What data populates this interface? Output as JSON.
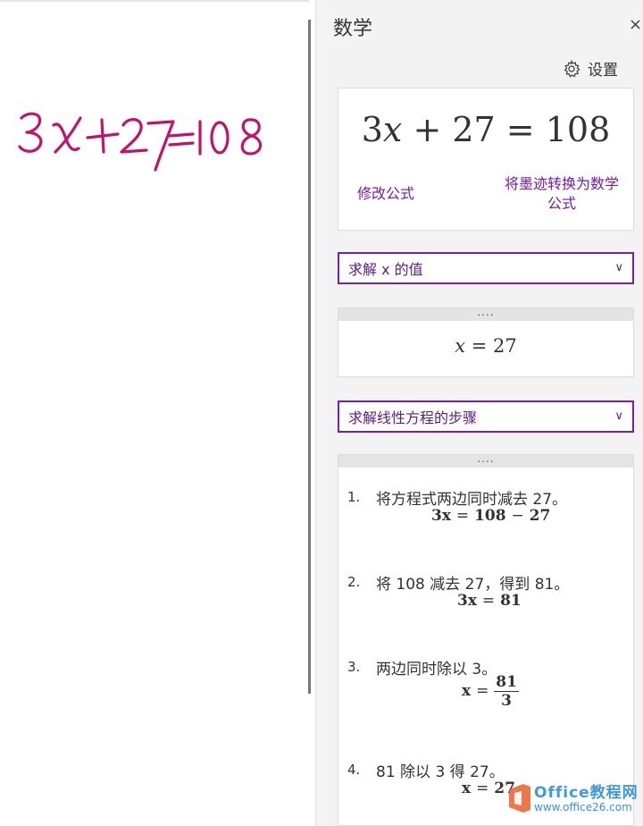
{
  "canvas": {
    "ink_equation": "3x+27=108",
    "ink_color": "#c0136b"
  },
  "pane": {
    "title": "数学",
    "close_label": "×",
    "settings_label": "设置"
  },
  "equation_card": {
    "display": {
      "coef": "3",
      "var": "x",
      "rest": "+ 27 = 108"
    },
    "edit_link": "修改公式",
    "convert_link": "将墨迹转换为数学公式"
  },
  "action_select": {
    "value": "求解 x 的值"
  },
  "result_card": {
    "dots": "....",
    "var": "x",
    "rest": "= 27"
  },
  "steps_select": {
    "value": "求解线性方程的步骤"
  },
  "steps_card": {
    "dots": "....",
    "steps": [
      {
        "num": "1.",
        "text": "将方程式两边同时减去 27。",
        "lhs": "3x",
        "op1": "=",
        "a": "108",
        "op2": "−",
        "b": "27"
      },
      {
        "num": "2.",
        "text": "将 108 减去 27，得到 81。",
        "lhs": "3x",
        "op1": "=",
        "a": "81"
      },
      {
        "num": "3.",
        "text": "两边同时除以 3。",
        "lhs": "x",
        "op1": "=",
        "num_val": "81",
        "den_val": "3"
      },
      {
        "num": "4.",
        "text": "81 除以 3 得 27。",
        "lhs": "x",
        "op1": "=",
        "a": "27"
      }
    ]
  },
  "watermark": {
    "title": "Office教程网",
    "url": "www.office26.com"
  },
  "colors": {
    "accent": "#7719aa",
    "select_border": "#7a1fa2",
    "pane_bg": "#f3f3f3"
  }
}
